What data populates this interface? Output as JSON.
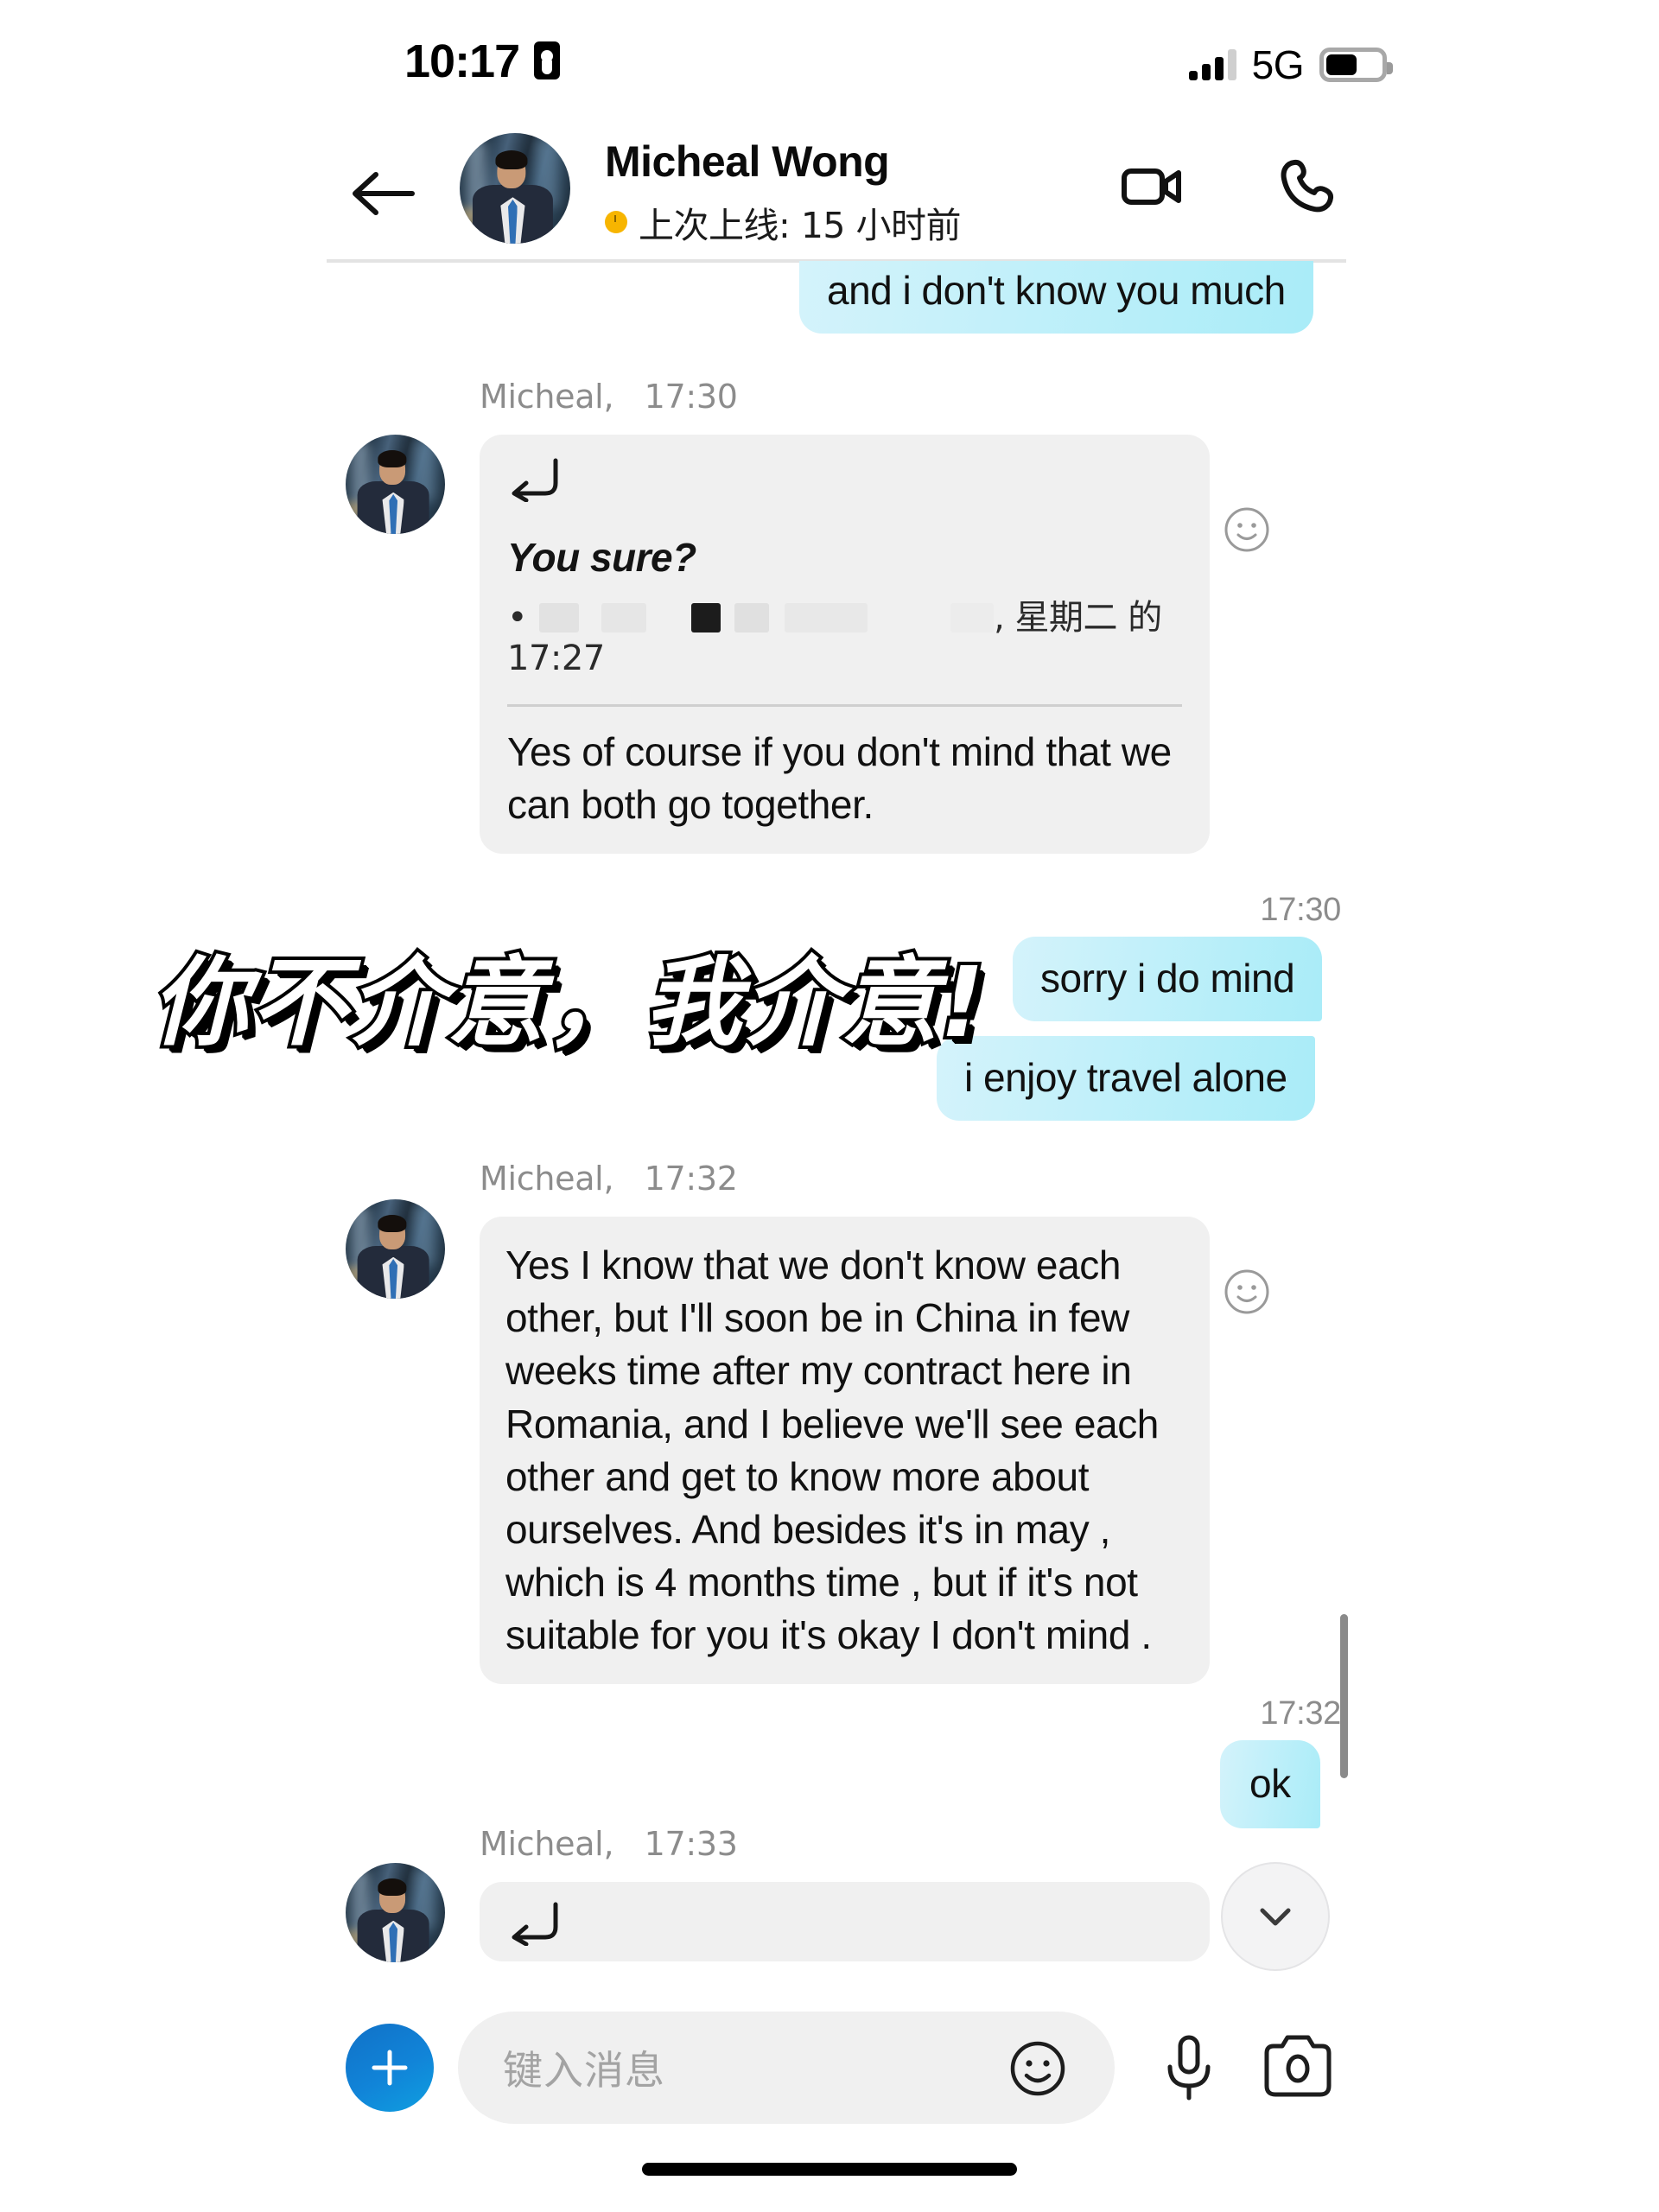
{
  "status_bar": {
    "time": "10:17",
    "lock_icon": "screen-lock-portrait-icon",
    "network": "5G",
    "signal_icon": "signal-bars-icon",
    "battery_icon": "battery-icon",
    "battery_level_pct": 52
  },
  "header": {
    "back_icon": "back-arrow-icon",
    "avatar_icon": "contact-avatar",
    "contact_name": "Micheal Wong",
    "presence_text": "上次上线: 15 小时前",
    "presence_dot_color": "#f7b500",
    "video_call_icon": "video-camera-icon",
    "voice_call_icon": "phone-call-icon"
  },
  "theme": {
    "outgoing_bubble_start": "#d4f3fb",
    "outgoing_bubble_end": "#a9ecf8",
    "incoming_bubble": "#f0f0f0",
    "meta_text": "#8c8c8c",
    "accent_blue": "#1184d8"
  },
  "overlay": {
    "meme_text": "你不介意，我介意!"
  },
  "messages": [
    {
      "id": "m1",
      "direction": "outgoing",
      "text": "and i don't know you much",
      "clipped_top": true
    },
    {
      "id": "m2",
      "direction": "incoming",
      "sender": "Micheal,",
      "time": "17:30",
      "reply_icon": "reply-arrow-icon",
      "quote": {
        "title": "You sure?",
        "redacted_prefix": "...",
        "sub_suffix": ", 星期二 的",
        "sub_time": "17:27"
      },
      "text": "Yes of course if you don't mind that we can both go together.",
      "reaction_icon": "add-reaction-smiley-icon"
    },
    {
      "id": "m3",
      "direction": "outgoing",
      "time": "17:30",
      "text": "sorry i do mind"
    },
    {
      "id": "m4",
      "direction": "outgoing",
      "text": "i enjoy travel alone"
    },
    {
      "id": "m5",
      "direction": "incoming",
      "sender": "Micheal,",
      "time": "17:32",
      "text": "Yes I know that we don't know each other, but I'll soon be in China in few weeks time after my contract here in Romania, and I believe we'll see each other and get to know more about ourselves. And besides it's in may , which is 4 months time , but if it's not suitable for you it's okay I don't mind .",
      "reaction_icon": "add-reaction-smiley-icon"
    },
    {
      "id": "m6",
      "direction": "outgoing",
      "time": "17:32",
      "text": "ok"
    },
    {
      "id": "m7",
      "direction": "incoming",
      "sender": "Micheal,",
      "time": "17:33",
      "reply_icon": "reply-arrow-icon",
      "text": ""
    }
  ],
  "scroll_down_button": {
    "icon": "chevron-down-icon"
  },
  "composer": {
    "add_icon": "plus-icon",
    "placeholder": "键入消息",
    "value": "",
    "emoji_icon": "emoji-smiley-icon",
    "mic_icon": "microphone-icon",
    "camera_icon": "camera-icon"
  },
  "home_indicator": "home-indicator-bar"
}
